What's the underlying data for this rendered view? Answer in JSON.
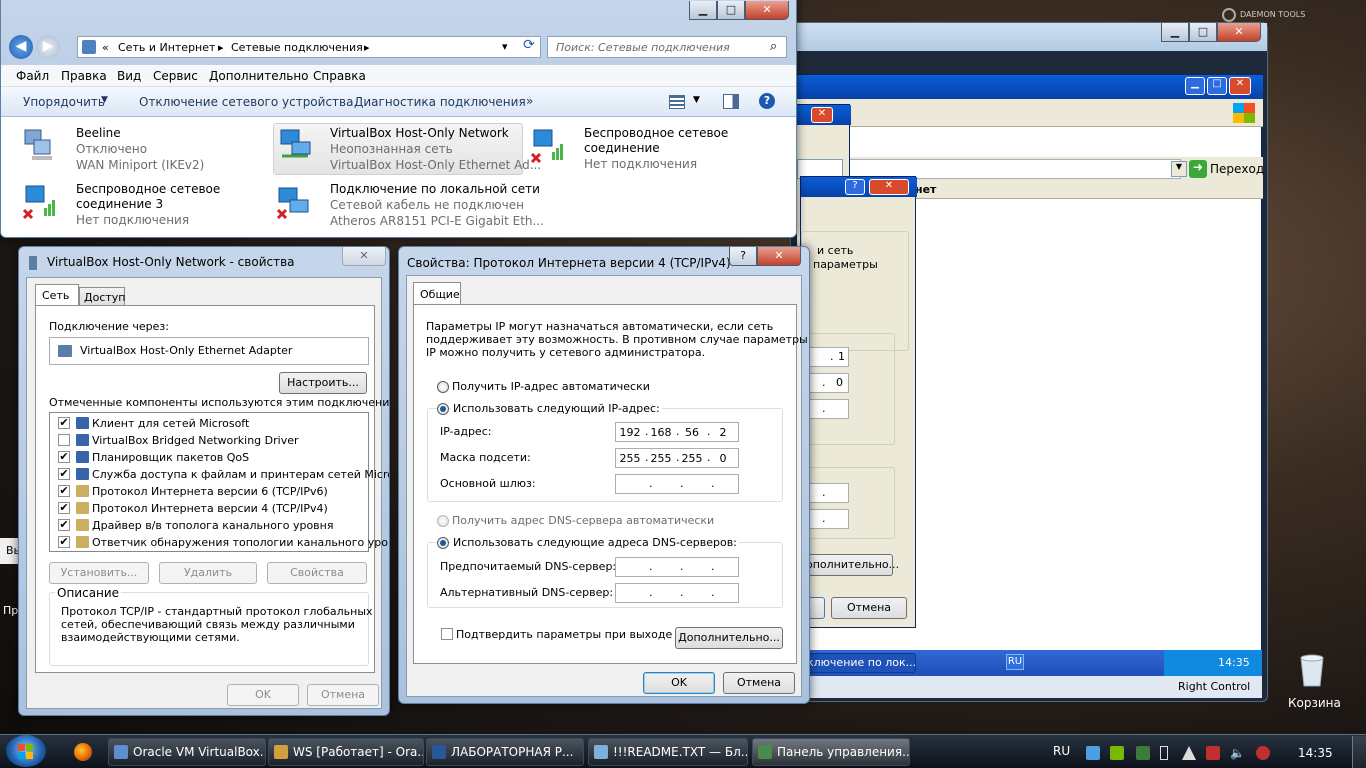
{
  "explorer": {
    "breadcrumb": [
      "«",
      "Сеть и Интернет",
      "Сетевые подключения"
    ],
    "search_placeholder": "Поиск: Сетевые подключения",
    "menu": [
      "Файл",
      "Правка",
      "Вид",
      "Сервис",
      "Дополнительно",
      "Справка"
    ],
    "toolbar": {
      "organize": "Упорядочить",
      "disable": "Отключение сетевого устройства",
      "diagnose": "Диагностика подключения",
      "more": "»"
    },
    "connections": [
      {
        "name": "Beeline",
        "status": "Отключено",
        "device": "WAN Miniport (IKEv2)"
      },
      {
        "name": "VirtualBox Host-Only Network",
        "status": "Неопознанная сеть",
        "device": "VirtualBox Host-Only Ethernet Ad..."
      },
      {
        "name": "Беспроводное сетевое",
        "name2": "соединение",
        "status": "Нет подключения"
      },
      {
        "name": "Беспроводное сетевое",
        "name2": "соединение 3",
        "status": "Нет подключения"
      },
      {
        "name": "Подключение по локальной сети",
        "status": "Сетевой кабель не подключен",
        "device": "Atheros AR8151 PCI-E Gigabit Eth..."
      }
    ]
  },
  "props": {
    "title": "VirtualBox Host-Only Network - свойства",
    "tabs": [
      "Сеть",
      "Доступ"
    ],
    "connect_via": "Подключение через:",
    "adapter": "VirtualBox Host-Only Ethernet Adapter",
    "configure": "Настроить...",
    "components_label": "Отмеченные компоненты используются этим подключением:",
    "components": [
      {
        "label": "Клиент для сетей Microsoft",
        "checked": true
      },
      {
        "label": "VirtualBox Bridged Networking Driver",
        "checked": false
      },
      {
        "label": "Планировщик пакетов QoS",
        "checked": true
      },
      {
        "label": "Служба доступа к файлам и принтерам сетей Micro...",
        "checked": true
      },
      {
        "label": "Протокол Интернета версии 6 (TCP/IPv6)",
        "checked": true
      },
      {
        "label": "Протокол Интернета версии 4 (TCP/IPv4)",
        "checked": true
      },
      {
        "label": "Драйвер в/в тополога канального уровня",
        "checked": true
      },
      {
        "label": "Ответчик обнаружения топологии канального уровня",
        "checked": true
      }
    ],
    "install": "Установить...",
    "remove": "Удалить",
    "properties": "Свойства",
    "description_title": "Описание",
    "description": [
      "Протокол TCP/IP - стандартный протокол глобальных",
      "сетей, обеспечивающий связь между различными",
      "взаимодействующими сетями."
    ],
    "ok": "OK",
    "cancel": "Отмена"
  },
  "ipv4": {
    "title": "Свойства: Протокол Интернета версии 4 (TCP/IPv4)",
    "tab": "Общие",
    "intro": [
      "Параметры IP могут назначаться автоматически, если сеть",
      "поддерживает эту возможность. В противном случае параметры",
      "IP можно получить у сетевого администратора."
    ],
    "auto_ip": "Получить IP-адрес автоматически",
    "manual_ip": "Использовать следующий IP-адрес:",
    "ip_label": "IP-адрес:",
    "ip": [
      "192",
      "168",
      "56",
      "2"
    ],
    "mask_label": "Маска подсети:",
    "mask": [
      "255",
      "255",
      "255",
      "0"
    ],
    "gateway_label": "Основной шлюз:",
    "auto_dns": "Получить адрес DNS-сервера автоматически",
    "manual_dns": "Использовать следующие адреса DNS-серверов:",
    "pref_dns": "Предпочитаемый DNS-сервер:",
    "alt_dns": "Альтернативный DNS-сервер:",
    "validate": "Подтвердить параметры при выходе",
    "advanced": "Дополнительно...",
    "ok": "OK",
    "cancel": "Отмена"
  },
  "bg": {
    "go": "Переход",
    "frag1": "нет",
    "frag2": "и сеть",
    "frag3": "параметры",
    "ip_a": "1",
    "ip_b": "0",
    "adv": "ополнительно...",
    "cancel": "Отмена",
    "task": "ключение по лок...",
    "lang": "RU",
    "time": "14:35",
    "vbox_right": "Right Control",
    "left1": "Вы",
    "left2": "Пр",
    "recycle": "Корзина",
    "dt": "DAEMON TOOLS"
  },
  "taskbar": {
    "items": [
      "Oracle VM VirtualBox...",
      "WS [Работает] - Ora...",
      "ЛАБОРАТОРНАЯ Р...",
      "!!!README.TXT — Бл...",
      "Панель управления..."
    ],
    "lang": "RU",
    "time": "14:35"
  }
}
